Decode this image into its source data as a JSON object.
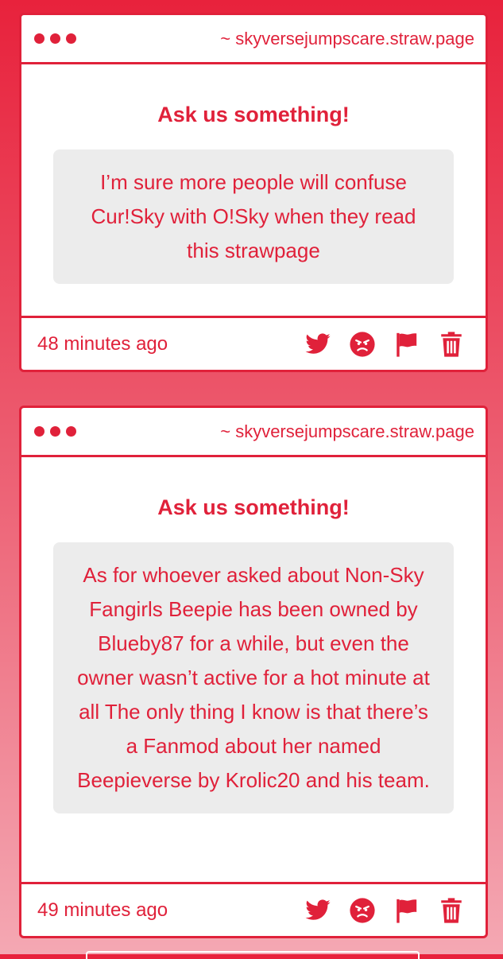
{
  "posts": [
    {
      "site": "~ skyversejumpscare.straw.page",
      "heading": "Ask us something!",
      "message": "I’m sure more people will confuse Cur!Sky with O!Sky when they read this strawpage",
      "time": "48 minutes ago"
    },
    {
      "site": "~ skyversejumpscare.straw.page",
      "heading": "Ask us something!",
      "message": "As for whoever asked about Non-Sky Fangirls Beepie has been owned by Blueby87 for a while, but even the owner wasn’t active for a hot minute at all The only thing I know is that there’s a Fanmod about her named Beepieverse by Krolic20 and his team.",
      "time": "49 minutes ago"
    }
  ],
  "icons": [
    "twitter-icon",
    "angry-face-icon",
    "flag-icon",
    "trash-icon"
  ],
  "colors": {
    "accent": "#e0213a",
    "message_bg": "#ececec",
    "card_bg": "#ffffff"
  }
}
